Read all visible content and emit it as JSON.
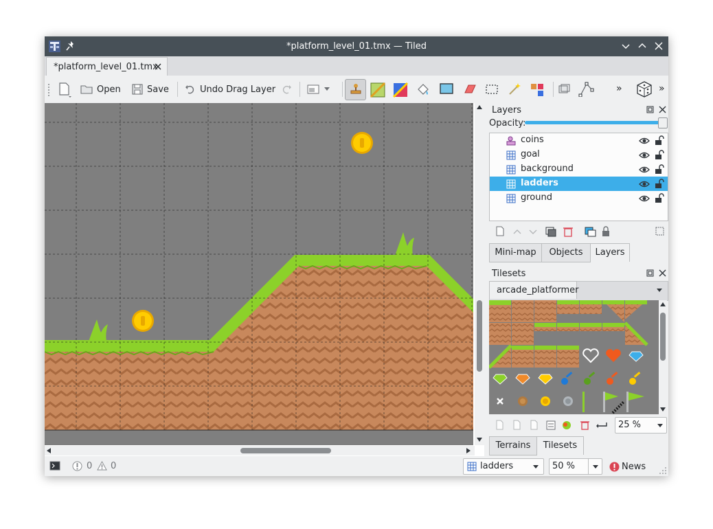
{
  "window": {
    "title": "*platform_level_01.tmx — Tiled"
  },
  "document_tab": {
    "label": "*platform_level_01.tmx"
  },
  "toolbar": {
    "open_label": "Open",
    "save_label": "Save",
    "undo_label": "Undo Drag Layer",
    "more_label": "»"
  },
  "layers_panel": {
    "title": "Layers",
    "opacity_label": "Opacity:",
    "opacity": 1.0,
    "layers": [
      {
        "name": "coins",
        "kind": "object-layer-icon",
        "selected": false
      },
      {
        "name": "goal",
        "kind": "tile-layer-icon",
        "selected": false
      },
      {
        "name": "background",
        "kind": "tile-layer-icon",
        "selected": false
      },
      {
        "name": "ladders",
        "kind": "tile-layer-icon",
        "selected": true
      },
      {
        "name": "ground",
        "kind": "tile-layer-icon",
        "selected": false
      }
    ],
    "tabs": [
      "Mini-map",
      "Objects",
      "Layers"
    ],
    "active_tab": "Layers"
  },
  "tilesets_panel": {
    "title": "Tilesets",
    "tileset_tab": "arcade_platformer",
    "zoom": "25 %",
    "tabs": [
      "Terrains",
      "Tilesets"
    ],
    "active_tab": "Tilesets"
  },
  "statusbar": {
    "error_count": "0",
    "warning_count": "0",
    "layer_combo": "ladders",
    "zoom_combo": "50 %",
    "news_label": "News"
  },
  "colors": {
    "titlebar": "#475057",
    "selection": "#3daee9",
    "grass": "#8cd12a",
    "dirt": "#c8885c",
    "coin": "#ffcc00",
    "map_background": "#7f7f7f"
  }
}
